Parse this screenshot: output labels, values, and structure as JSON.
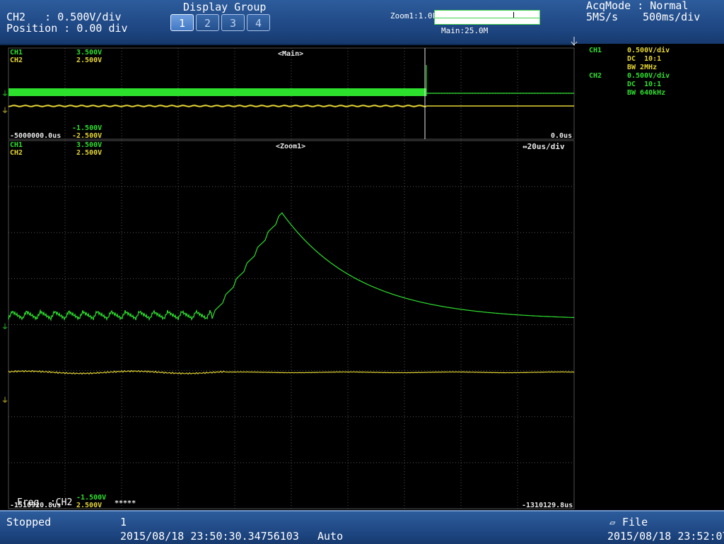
{
  "header": {
    "channel_line": "CH2   : 0.500V/div",
    "position_line": "Position : 0.00 div",
    "display_group_label": "Display Group",
    "display_groups": [
      "1",
      "2",
      "3",
      "4"
    ],
    "active_group": "1",
    "zoom_label": "Zoom1:1.0k",
    "main_label": "Main:25.0M",
    "acqmode_line": "AcqMode : Normal",
    "sample_rate": "5MS/s",
    "timebase": "500ms/div"
  },
  "main_panel": {
    "title": "<Main>",
    "ch1_label": "CH1",
    "ch1_top": "3.500V",
    "ch2_label": "CH2",
    "ch2_top": "2.500V",
    "ch1_bottom": "-1.500V",
    "ch2_bottom": "-2.500V",
    "time_left": "-5000000.0us",
    "time_right": "0.0us"
  },
  "zoom_panel": {
    "title": "<Zoom1>",
    "timebase": "↔20us/div",
    "ch1_label": "CH1",
    "ch1_top": "3.500V",
    "ch2_label": "CH2",
    "ch2_top": "2.500V",
    "ch1_bottom": "-1.500V",
    "ch2_bottom": "2.500V",
    "time_left": "-1510920.8us",
    "time_right": "-1310129.8us",
    "measure_label": "Freq  :CH2",
    "measure_value": "*****"
  },
  "side": {
    "ch1": {
      "label": "CH1",
      "scale": "0.500V/div",
      "coupling": "DC  10:1",
      "bw": "BW 2MHz"
    },
    "ch2": {
      "label": "CH2",
      "scale": "0.500V/div",
      "coupling": "DC  10:1",
      "bw": "BW 640kHz"
    }
  },
  "footer": {
    "status": "Stopped",
    "acq_count": "1",
    "trigger_time": "2015/08/18 23:50:30.34756103",
    "trigger_mode": "Auto",
    "file_label": "File",
    "clock": "2015/08/18 23:52:07"
  },
  "colors": {
    "ch1": "#2ee02e",
    "ch2": "#e4d534",
    "bar": "#1d4580"
  }
}
